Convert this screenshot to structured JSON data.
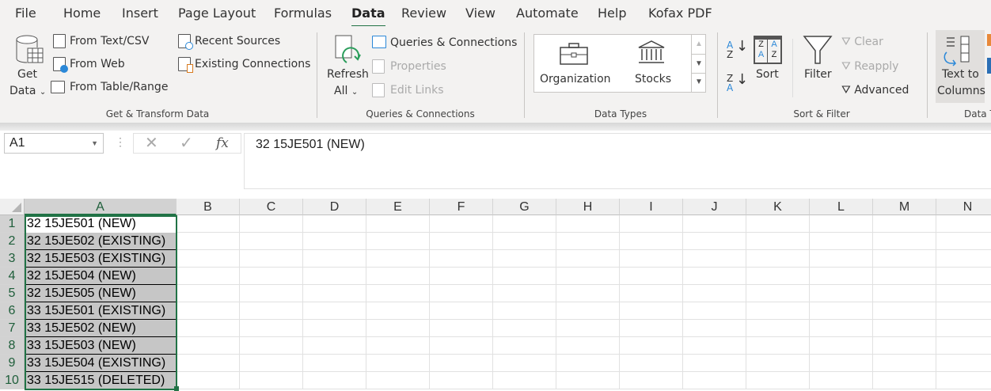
{
  "tabs": [
    "File",
    "Home",
    "Insert",
    "Page Layout",
    "Formulas",
    "Data",
    "Review",
    "View",
    "Automate",
    "Help",
    "Kofax PDF"
  ],
  "active_tab": "Data",
  "ribbon": {
    "get_data": [
      "Get",
      "Data"
    ],
    "from_text_csv": "From Text/CSV",
    "from_web": "From Web",
    "from_table_range": "From Table/Range",
    "recent_sources": "Recent Sources",
    "existing_connections": "Existing Connections",
    "group_get_transform": "Get & Transform Data",
    "refresh_all": [
      "Refresh",
      "All"
    ],
    "queries_connections": "Queries & Connections",
    "properties": "Properties",
    "edit_links": "Edit Links",
    "group_queries": "Queries & Connections",
    "organization": "Organization",
    "stocks": "Stocks",
    "group_data_types": "Data Types",
    "sort": "Sort",
    "filter": "Filter",
    "clear": "Clear",
    "reapply": "Reapply",
    "advanced": "Advanced",
    "group_sort_filter": "Sort & Filter",
    "text_to_columns": [
      "Text to",
      "Columns"
    ],
    "group_data_tools": "Data T"
  },
  "formula_bar": {
    "name_box": "A1",
    "fx": "fx",
    "content": "32 15JE501 (NEW)"
  },
  "columns": [
    "A",
    "B",
    "C",
    "D",
    "E",
    "F",
    "G",
    "H",
    "I",
    "J",
    "K",
    "L",
    "M",
    "N"
  ],
  "rows": [
    "32 15JE501 (NEW)",
    "32 15JE502 (EXISTING)",
    "32 15JE503 (EXISTING)",
    "32 15JE504 (NEW)",
    "32 15JE505 (NEW)",
    "33 15JE501 (EXISTING)",
    "33 15JE502 (NEW)",
    "33 15JE503 (NEW)",
    "33 15JE504 (EXISTING)",
    "33 15JE515 (DELETED)"
  ],
  "colors": {
    "accent": "#217346",
    "selection": "#c6c6c6"
  }
}
